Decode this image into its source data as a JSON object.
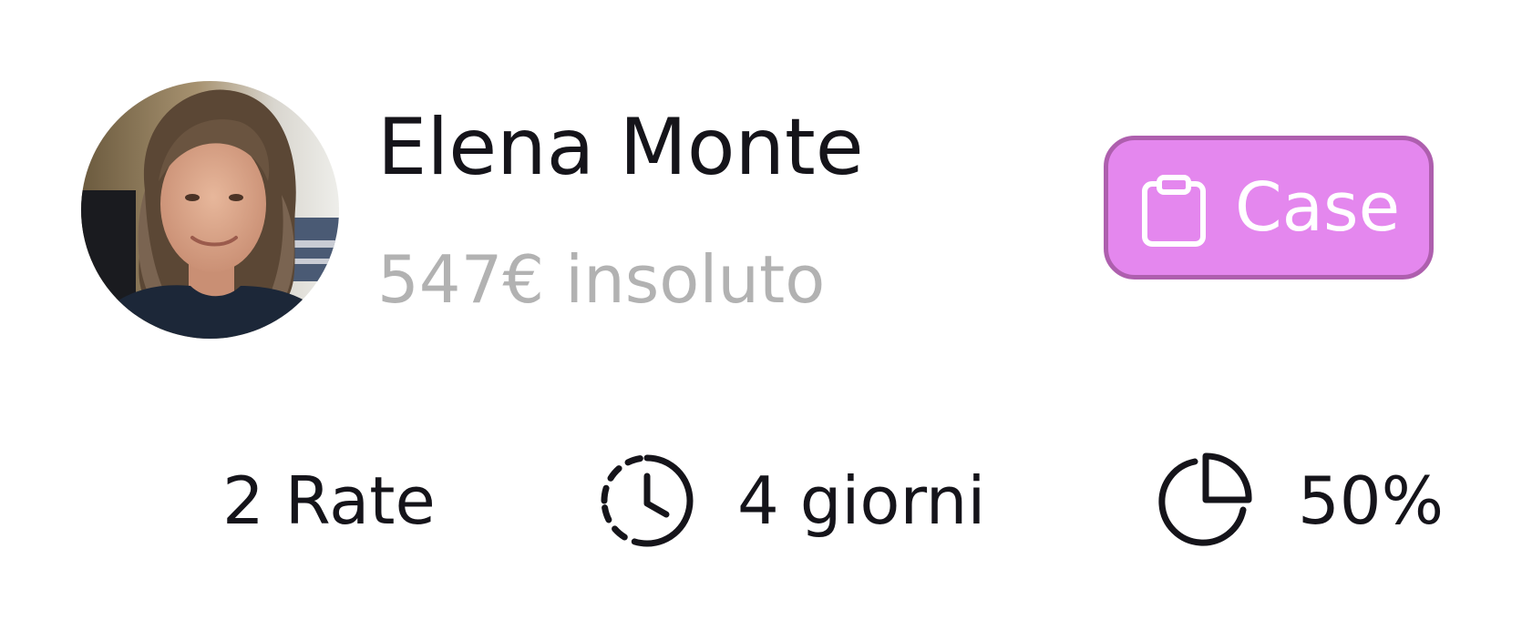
{
  "customer": {
    "name": "Elena Monte",
    "debt_text": "547€ insoluto"
  },
  "case_button": {
    "label": "Case",
    "icon": "clipboard-icon",
    "background": "#e487ee",
    "border": "#ae5fae"
  },
  "stats": {
    "installments": "2 Rate",
    "days": {
      "icon": "clock-dashed-icon",
      "text": "4 giorni"
    },
    "percent": {
      "icon": "pie-chart-icon",
      "text": "50%"
    }
  }
}
